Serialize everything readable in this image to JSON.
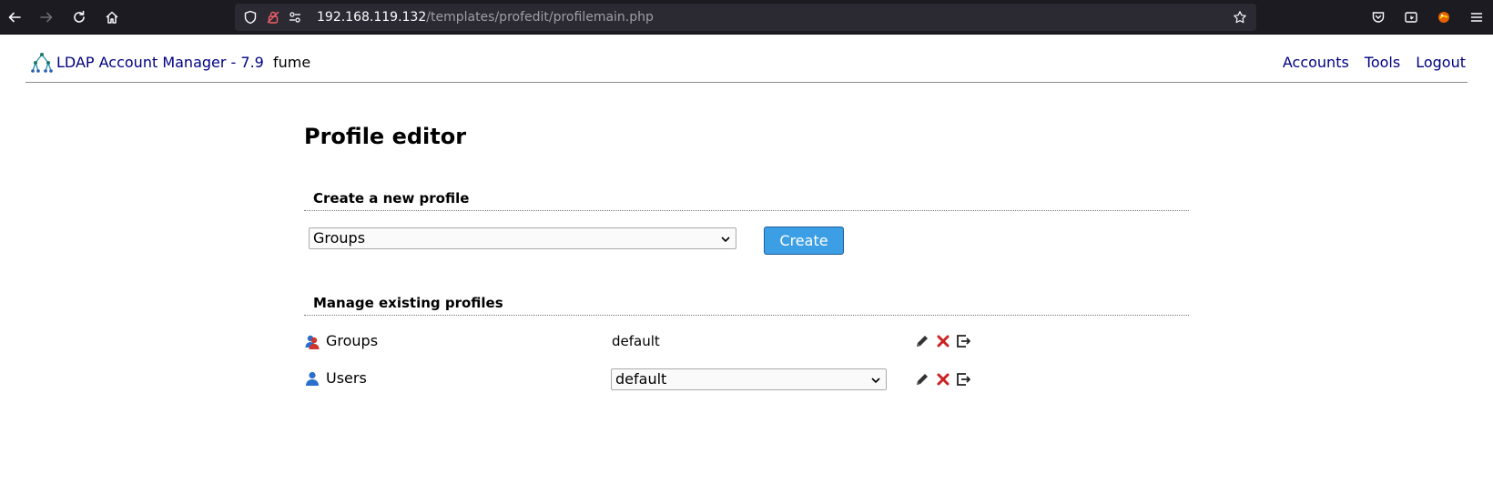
{
  "browser": {
    "url_host": "192.168.119.132",
    "url_path": "/templates/profedit/profilemain.php"
  },
  "header": {
    "app_title": "LDAP Account Manager - 7.9",
    "user": "fume",
    "nav": [
      "Accounts",
      "Tools",
      "Logout"
    ]
  },
  "page": {
    "title": "Profile editor",
    "create_section": {
      "heading": "Create a new profile",
      "type_selected": "Groups",
      "create_label": "Create"
    },
    "manage_section": {
      "heading": "Manage existing profiles",
      "rows": [
        {
          "type": "Groups",
          "icon": "group-icon",
          "profile": "default",
          "profile_is_select": false
        },
        {
          "type": "Users",
          "icon": "user-icon",
          "profile": "default",
          "profile_is_select": true
        }
      ]
    }
  },
  "colors": {
    "link": "#000080",
    "button": "#3c9fe5",
    "delete": "#cc2222"
  }
}
